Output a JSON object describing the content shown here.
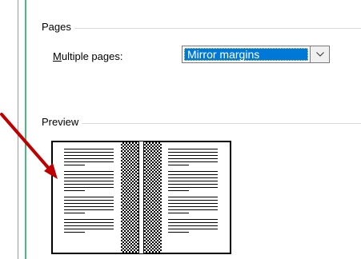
{
  "pages_group": {
    "title": "Pages",
    "multiple_pages_label_accel": "M",
    "multiple_pages_label_rest": "ultiple pages:",
    "multiple_pages_value": "Mirror margins"
  },
  "preview_group": {
    "title": "Preview"
  },
  "colors": {
    "selection": "#0078d7",
    "arrow": "#c00000",
    "green_line": "#49b97c"
  },
  "icons": {
    "dropdown": "chevron-down-icon",
    "annotation": "red-arrow-icon"
  }
}
